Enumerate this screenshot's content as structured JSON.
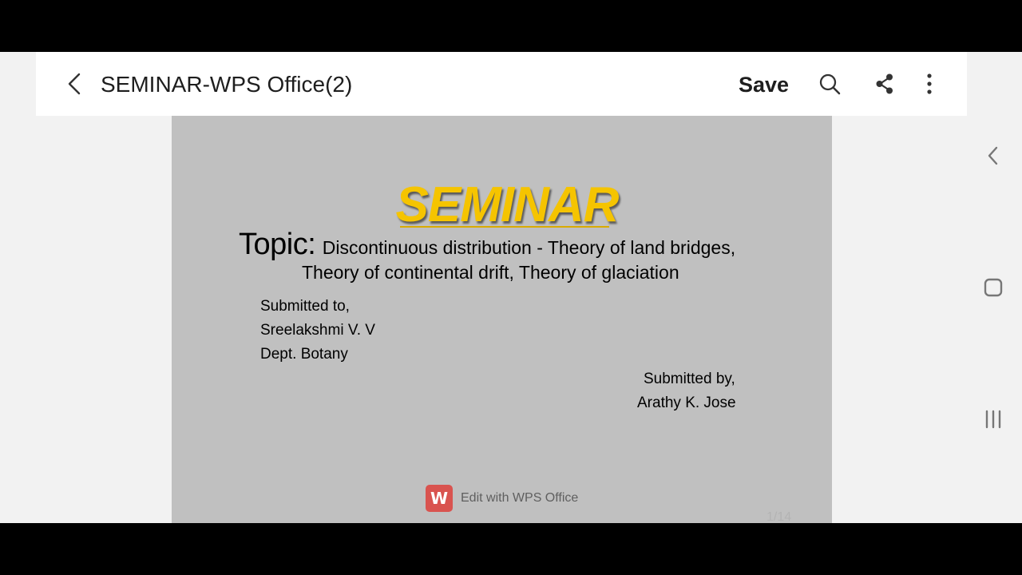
{
  "app_bar": {
    "title": "SEMINAR-WPS Office(2)",
    "save_label": "Save",
    "icons": [
      "back-arrow-icon",
      "search-icon",
      "share-icon",
      "more-vertical-icon"
    ]
  },
  "slide": {
    "heading": "SEMINAR",
    "topic_label": "Topic:",
    "topic_text": "Discontinuous distribution - Theory of land bridges,",
    "topic_text_line2": "Theory of continental drift, Theory of glaciation",
    "submitted_to_label": "Submitted to,",
    "submitted_to_name": "Sreelakshmi V. V",
    "submitted_to_dept": "Dept. Botany",
    "submitted_by_label": "Submitted by,",
    "submitted_by_name": "Arathy K. Jose",
    "heading_color": "#f5c400",
    "background_color": "#c0c0c0"
  },
  "wps_badge": {
    "logo_letter": "W",
    "label": "Edit with WPS Office",
    "color": "#d9534f"
  },
  "page_indicator": "1/14",
  "system_nav": {
    "icons": [
      "back-chevron-icon",
      "home-icon",
      "recents-icon"
    ]
  }
}
